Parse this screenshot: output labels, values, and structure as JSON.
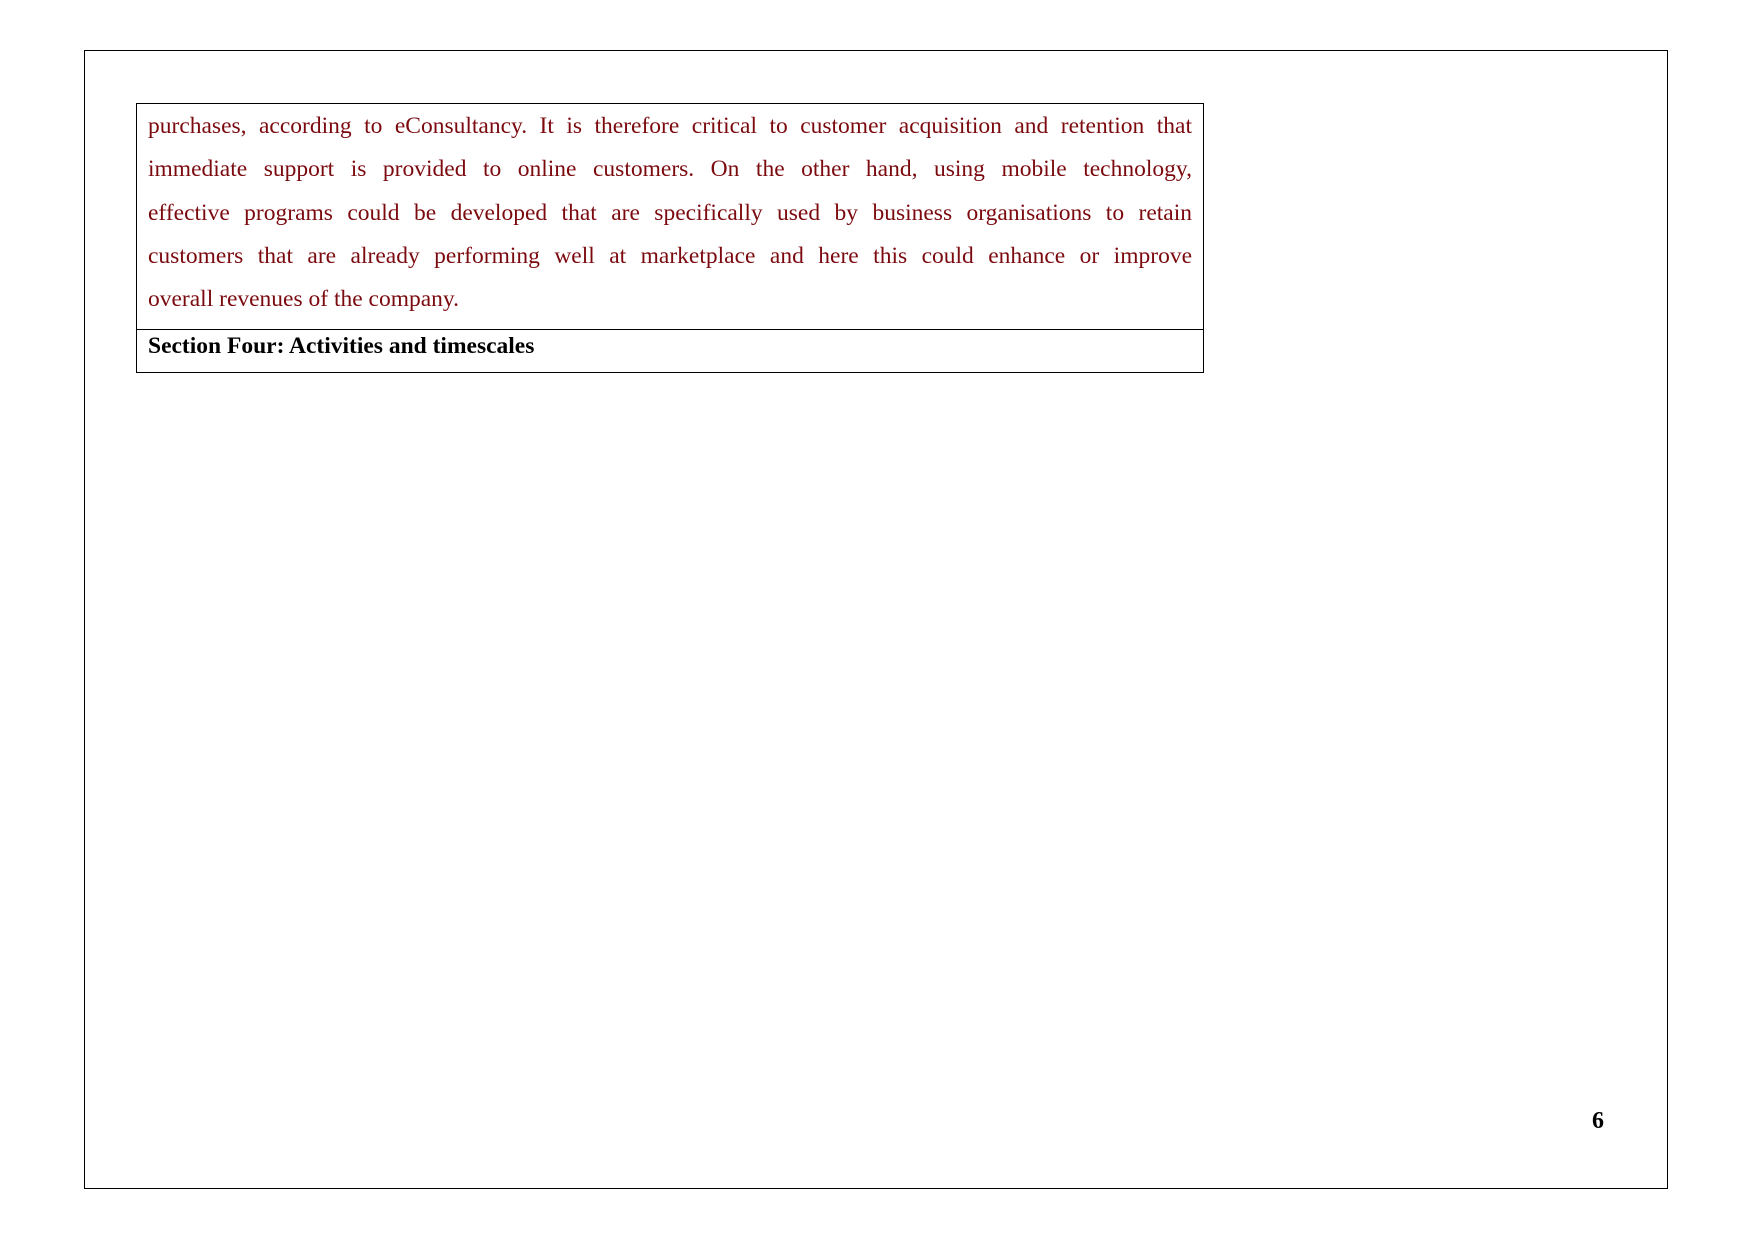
{
  "document": {
    "body_lines": [
      "purchases, according to eConsultancy. It is therefore critical to customer acquisition and retention that",
      "immediate support is provided to online customers. On the other hand, using mobile technology,",
      "effective programs could be developed that are specifically used by business organisations to retain",
      "customers that are already performing well at marketplace and here this could enhance or improve",
      "overall revenues of the company."
    ],
    "section_heading": "Section Four: Activities and timescales",
    "page_number": "6"
  },
  "colors": {
    "body_text": "#7b0a0f",
    "heading_text": "#000000"
  }
}
